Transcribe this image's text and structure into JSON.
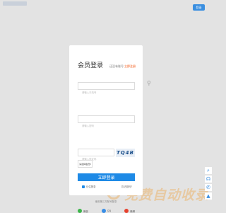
{
  "panel": {
    "title": "会员登录",
    "no_account_text": "还没有账号",
    "register_link": "立即注册"
  },
  "form": {
    "username_placeholder": "请输入手机号",
    "password_placeholder": "请输入密码",
    "captcha_placeholder": "请输入验证码",
    "captcha_text": "TQ4B",
    "member_type": "请选择会员▾",
    "login_button": "立即登录",
    "remember_label": "记住登录",
    "forgot_link": "忘记密码?"
  },
  "third_party": {
    "title": "使用第三方账号登录",
    "items": [
      {
        "label": "微信",
        "color": "#3bb54a"
      },
      {
        "label": "QQ",
        "color": "#3a8ee6"
      },
      {
        "label": "微博",
        "color": "#e6412e"
      }
    ]
  },
  "background": {
    "logo_text": "免费自动收录",
    "top_button": "登录"
  },
  "colors": {
    "primary": "#1e8ae6",
    "register": "#f24a00"
  },
  "side_rail": {
    "icons": [
      "search-icon",
      "headset-icon",
      "phone-icon",
      "up-arrow-icon"
    ]
  }
}
